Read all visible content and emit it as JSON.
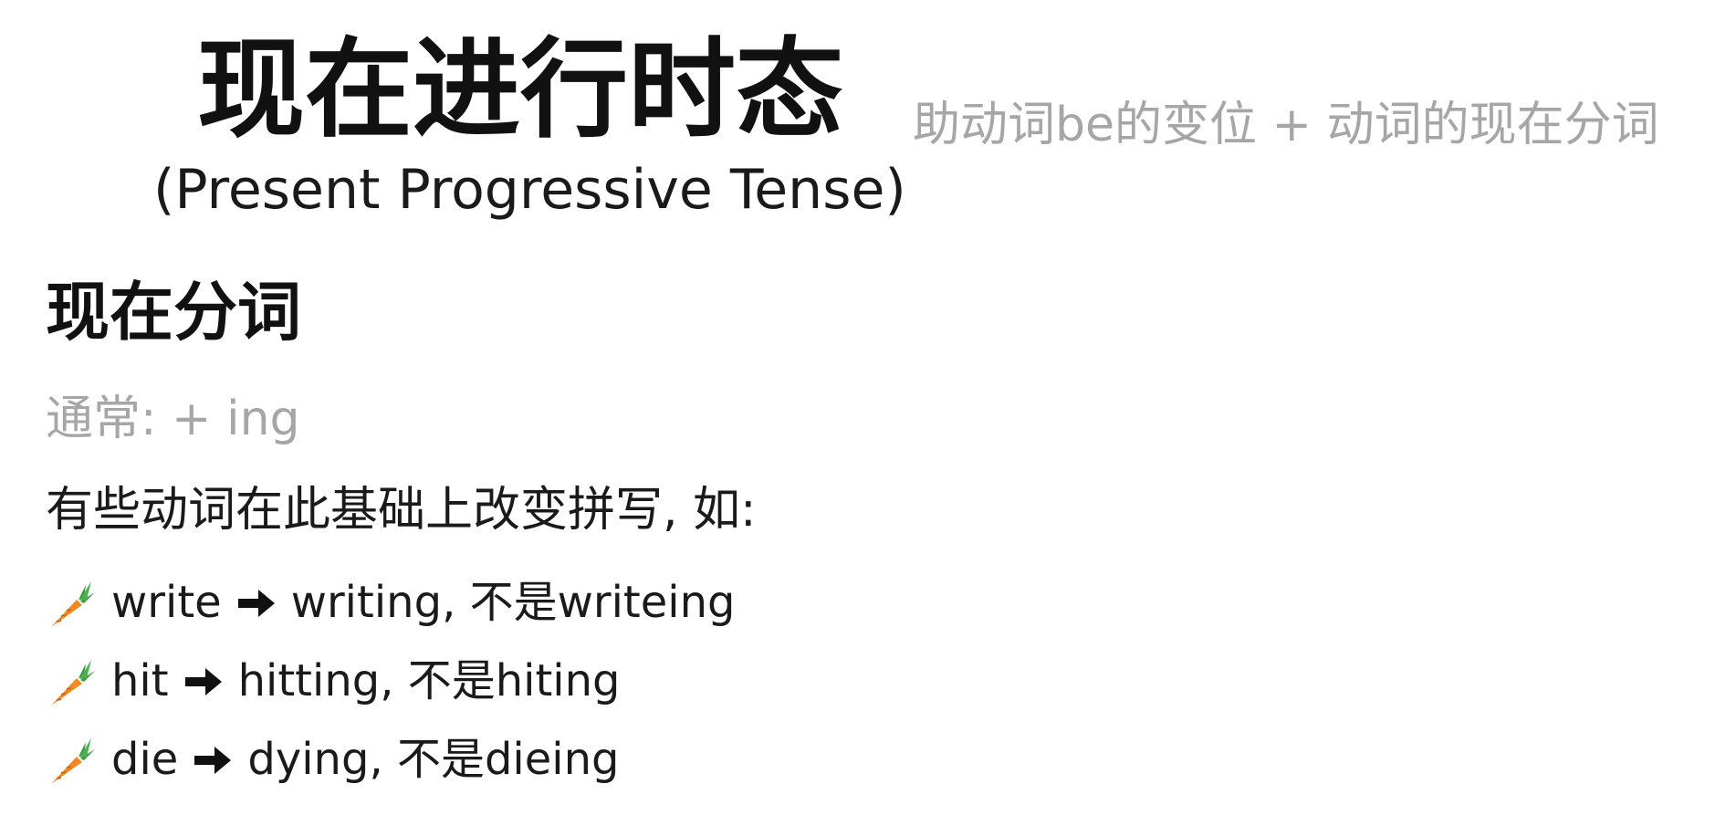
{
  "title": "现在进行时态",
  "subtitle": "(Present Progressive Tense)",
  "formula": "助动词be的变位 + 动词的现在分词",
  "section": {
    "heading": "现在分词",
    "general_rule": "通常: + ing",
    "note": "有些动词在此基础上改变拼写, 如:"
  },
  "examples": [
    {
      "base": "write",
      "result": "writing, 不是writeing"
    },
    {
      "base": "hit",
      "result": "hitting, 不是hiting"
    },
    {
      "base": "die",
      "result": "dying, 不是dieing"
    }
  ],
  "icons": {
    "bullet": "carrot-icon",
    "arrow": "right-arrow-icon"
  },
  "colors": {
    "text": "#1a1a1a",
    "muted": "#a6a6a6",
    "carrot_orange": "#f08a24",
    "carrot_green": "#3c9a3c"
  }
}
